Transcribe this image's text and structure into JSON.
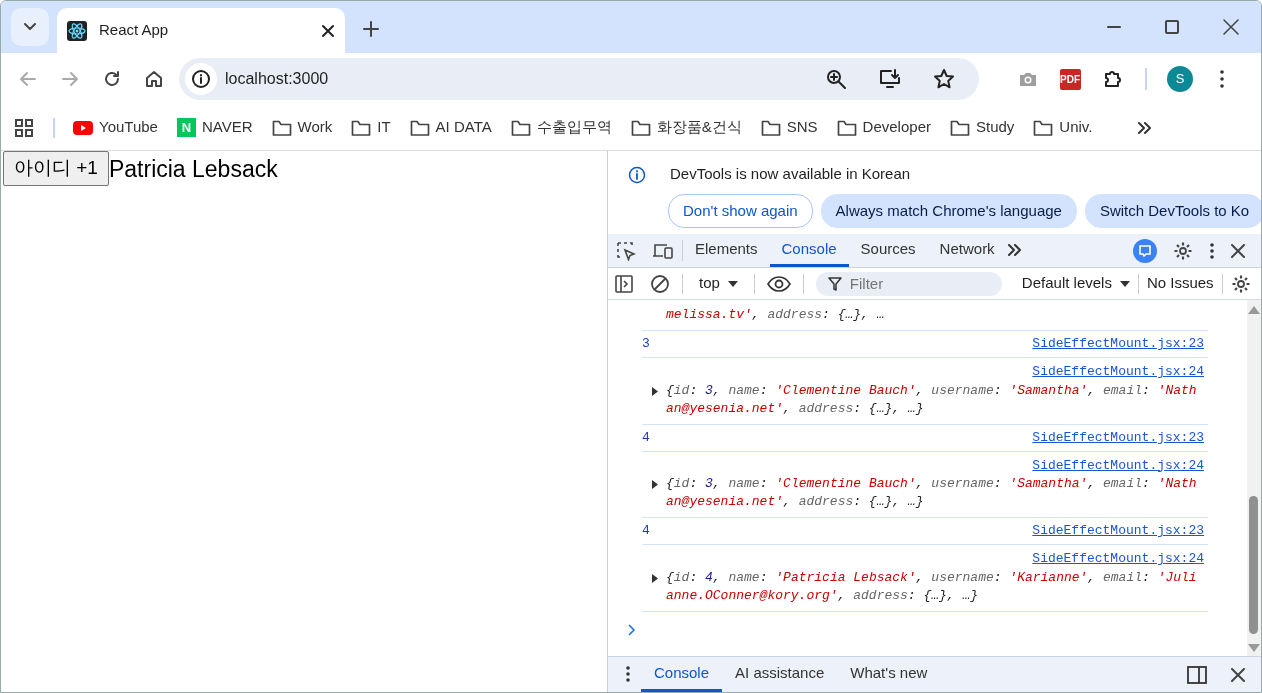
{
  "browser": {
    "tabs": [
      {
        "title": "React App",
        "selected": true
      }
    ],
    "url": "localhost:3000",
    "profile_initial": "S",
    "extension_label": "PDF",
    "bookmarks": [
      {
        "label": "YouTube",
        "kind": "youtube"
      },
      {
        "label": "NAVER",
        "kind": "naver",
        "icon_text": "N"
      },
      {
        "label": "Work",
        "kind": "folder"
      },
      {
        "label": "IT",
        "kind": "folder"
      },
      {
        "label": "AI DATA",
        "kind": "folder"
      },
      {
        "label": "수출입무역",
        "kind": "folder"
      },
      {
        "label": "화장품&건식",
        "kind": "folder"
      },
      {
        "label": "SNS",
        "kind": "folder"
      },
      {
        "label": "Developer",
        "kind": "folder"
      },
      {
        "label": "Study",
        "kind": "folder"
      },
      {
        "label": "Univ.",
        "kind": "folder"
      }
    ]
  },
  "page": {
    "button": "아이디 +1",
    "name": "Patricia Lebsack"
  },
  "devtools": {
    "infobar": {
      "message": "DevTools is now available in Korean",
      "buttons": [
        {
          "label": "Don't show again",
          "kind": "outline"
        },
        {
          "label": "Always match Chrome's language",
          "kind": "filled"
        },
        {
          "label": "Switch DevTools to Ko",
          "kind": "filled"
        }
      ]
    },
    "tabs": [
      {
        "label": "Elements",
        "selected": false
      },
      {
        "label": "Console",
        "selected": true
      },
      {
        "label": "Sources",
        "selected": false
      },
      {
        "label": "Network",
        "selected": false
      }
    ],
    "console_toolbar": {
      "context": "top",
      "filter_placeholder": "Filter",
      "levels": "Default levels",
      "issues": "No Issues"
    },
    "logs": [
      {
        "kind": "continuation",
        "segments": [
          {
            "kind": "str",
            "text": "melissa.tv'"
          },
          {
            "kind": "punct",
            "text": ", "
          },
          {
            "kind": "key",
            "text": "address"
          },
          {
            "kind": "punct",
            "text": ": {…}, …"
          }
        ]
      },
      {
        "kind": "value",
        "text": "3",
        "source": "SideEffectMount.jsx:23"
      },
      {
        "kind": "object",
        "source": "SideEffectMount.jsx:24",
        "segments": [
          {
            "kind": "punct",
            "text": "{"
          },
          {
            "kind": "key",
            "text": "id"
          },
          {
            "kind": "punct",
            "text": ": "
          },
          {
            "kind": "num",
            "text": "3"
          },
          {
            "kind": "punct",
            "text": ", "
          },
          {
            "kind": "key",
            "text": "name"
          },
          {
            "kind": "punct",
            "text": ": "
          },
          {
            "kind": "str",
            "text": "'Clementine Bauch'"
          },
          {
            "kind": "punct",
            "text": ", "
          },
          {
            "kind": "key",
            "text": "username"
          },
          {
            "kind": "punct",
            "text": ": "
          },
          {
            "kind": "str",
            "text": "'Samantha'"
          },
          {
            "kind": "punct",
            "text": ", "
          },
          {
            "kind": "key",
            "text": "email"
          },
          {
            "kind": "punct",
            "text": ": "
          },
          {
            "kind": "str",
            "text": "'Nathan@yesenia.net'"
          },
          {
            "kind": "punct",
            "text": ", "
          },
          {
            "kind": "key",
            "text": "address"
          },
          {
            "kind": "punct",
            "text": ": {…}, …}"
          }
        ]
      },
      {
        "kind": "value",
        "text": "4",
        "source": "SideEffectMount.jsx:23"
      },
      {
        "kind": "object",
        "source": "SideEffectMount.jsx:24",
        "segments": [
          {
            "kind": "punct",
            "text": "{"
          },
          {
            "kind": "key",
            "text": "id"
          },
          {
            "kind": "punct",
            "text": ": "
          },
          {
            "kind": "num",
            "text": "3"
          },
          {
            "kind": "punct",
            "text": ", "
          },
          {
            "kind": "key",
            "text": "name"
          },
          {
            "kind": "punct",
            "text": ": "
          },
          {
            "kind": "str",
            "text": "'Clementine Bauch'"
          },
          {
            "kind": "punct",
            "text": ", "
          },
          {
            "kind": "key",
            "text": "username"
          },
          {
            "kind": "punct",
            "text": ": "
          },
          {
            "kind": "str",
            "text": "'Samantha'"
          },
          {
            "kind": "punct",
            "text": ", "
          },
          {
            "kind": "key",
            "text": "email"
          },
          {
            "kind": "punct",
            "text": ": "
          },
          {
            "kind": "str",
            "text": "'Nathan@yesenia.net'"
          },
          {
            "kind": "punct",
            "text": ", "
          },
          {
            "kind": "key",
            "text": "address"
          },
          {
            "kind": "punct",
            "text": ": {…}, …}"
          }
        ]
      },
      {
        "kind": "value",
        "text": "4",
        "source": "SideEffectMount.jsx:23"
      },
      {
        "kind": "object",
        "source": "SideEffectMount.jsx:24",
        "segments": [
          {
            "kind": "punct",
            "text": "{"
          },
          {
            "kind": "key",
            "text": "id"
          },
          {
            "kind": "punct",
            "text": ": "
          },
          {
            "kind": "num",
            "text": "4"
          },
          {
            "kind": "punct",
            "text": ", "
          },
          {
            "kind": "key",
            "text": "name"
          },
          {
            "kind": "punct",
            "text": ": "
          },
          {
            "kind": "str",
            "text": "'Patricia Lebsack'"
          },
          {
            "kind": "punct",
            "text": ", "
          },
          {
            "kind": "key",
            "text": "username"
          },
          {
            "kind": "punct",
            "text": ": "
          },
          {
            "kind": "str",
            "text": "'Karianne'"
          },
          {
            "kind": "punct",
            "text": ", "
          },
          {
            "kind": "key",
            "text": "email"
          },
          {
            "kind": "punct",
            "text": ": "
          },
          {
            "kind": "str",
            "text": "'Julianne.OConner@kory.org'"
          },
          {
            "kind": "punct",
            "text": ", "
          },
          {
            "kind": "key",
            "text": "address"
          },
          {
            "kind": "punct",
            "text": ": {…}, …}"
          }
        ]
      }
    ],
    "drawer_tabs": [
      {
        "label": "Console",
        "selected": true
      },
      {
        "label": "AI assistance",
        "selected": false
      },
      {
        "label": "What's new",
        "selected": false
      }
    ]
  }
}
